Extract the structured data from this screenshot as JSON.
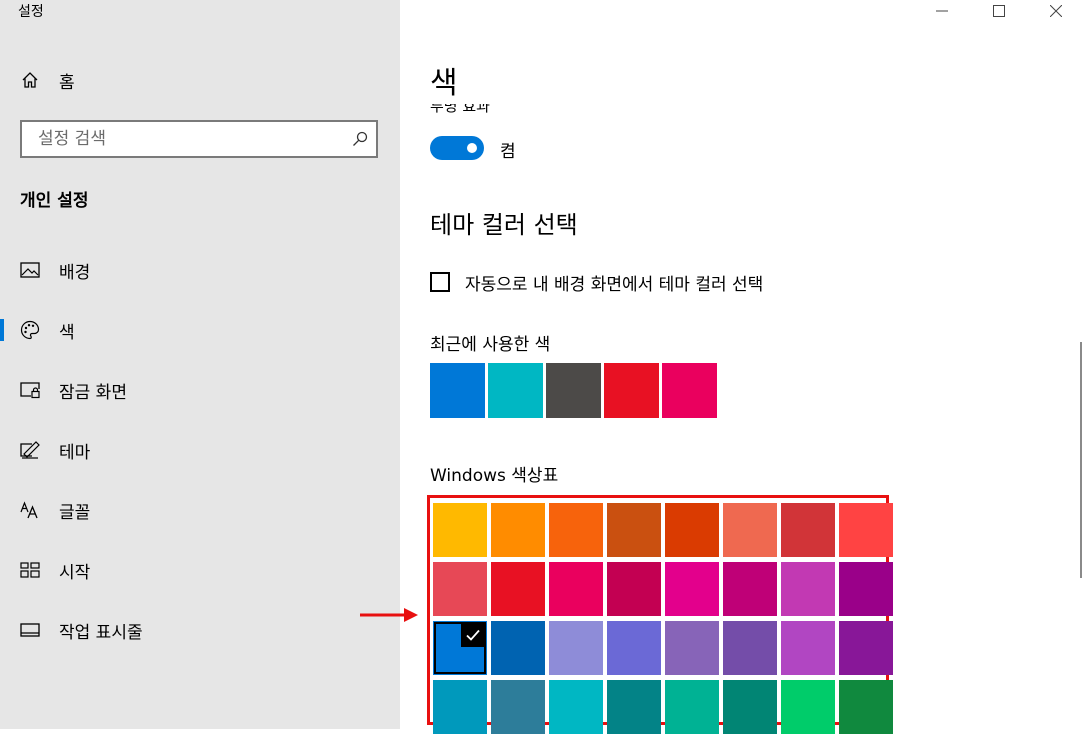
{
  "window": {
    "title": "설정",
    "controls": [
      "minimize",
      "maximize",
      "close"
    ]
  },
  "sidebar": {
    "home": {
      "label": "홈",
      "icon": "home-icon"
    },
    "search": {
      "placeholder": "설정 검색",
      "icon": "search-icon"
    },
    "section_heading": "개인 설정",
    "items": [
      {
        "label": "배경",
        "icon": "picture-icon",
        "selected": false
      },
      {
        "label": "색",
        "icon": "palette-icon",
        "selected": true
      },
      {
        "label": "잠금 화면",
        "icon": "lock-screen-icon",
        "selected": false
      },
      {
        "label": "테마",
        "icon": "theme-brush-icon",
        "selected": false
      },
      {
        "label": "글꼴",
        "icon": "font-icon",
        "selected": false
      },
      {
        "label": "시작",
        "icon": "start-menu-icon",
        "selected": false
      },
      {
        "label": "작업 표시줄",
        "icon": "taskbar-icon",
        "selected": false
      }
    ]
  },
  "main": {
    "title": "색",
    "transparency_label": "투명 효과",
    "transparency_toggle": {
      "state_label": "켬",
      "on": true
    },
    "theme_color_heading": "테마 컬러 선택",
    "auto_pick": {
      "label": "자동으로 내 배경 화면에서 테마 컬러 선택",
      "checked": false
    },
    "recent_heading": "최근에 사용한 색",
    "recent_colors": [
      "#0078d7",
      "#00b7c3",
      "#4c4a48",
      "#e81123",
      "#ea005e"
    ],
    "palette_heading": "Windows 색상표",
    "palette": [
      [
        "#ffb900",
        "#ff8c00",
        "#f7630c",
        "#ca5010",
        "#da3b01",
        "#ef6950",
        "#d13438",
        "#ff4343"
      ],
      [
        "#e74856",
        "#e81123",
        "#ea005e",
        "#c30052",
        "#e3008c",
        "#bf0077",
        "#c239b3",
        "#9a0089"
      ],
      [
        "#0078d7",
        "#0063b1",
        "#8e8cd8",
        "#6b69d6",
        "#8764b8",
        "#744da9",
        "#b146c2",
        "#881798"
      ],
      [
        "#0099bc",
        "#2d7d9a",
        "#00b7c3",
        "#038387",
        "#00b294",
        "#018574",
        "#00cc6a",
        "#10893e"
      ]
    ],
    "selected_palette": {
      "row": 2,
      "col": 0
    },
    "highlight_color": "#e81010",
    "accent_color": "#0078d7"
  }
}
